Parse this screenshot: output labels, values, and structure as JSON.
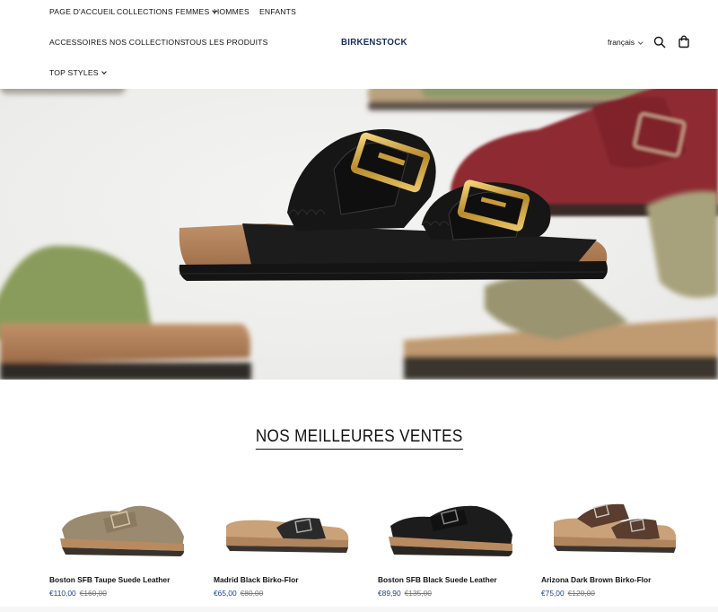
{
  "nav": {
    "items": [
      {
        "label": "PAGE D'ACCUEIL"
      },
      {
        "label": "COLLECTIONS FEMMES"
      },
      {
        "label": "HOMMES"
      },
      {
        "label": "ENFANTS"
      },
      {
        "label": "ACCESSOIRES"
      },
      {
        "label": "NOS COLLECTIONS"
      },
      {
        "label": "TOUS LES PRODUITS"
      },
      {
        "label": "TOP STYLES"
      }
    ]
  },
  "brand": {
    "logo": "BIRKENSTOCK",
    "color": "#1a2b5e"
  },
  "header": {
    "language": "français",
    "icons": [
      "search-icon",
      "shopping-bag-icon"
    ]
  },
  "hero": {
    "image": "sandals-collage"
  },
  "bestsellers": {
    "title": "NOS MEILLEURES VENTES",
    "products": [
      {
        "name": "Boston SFB Taupe Suede Leather",
        "price": "€110,00",
        "old_price": "€160,00",
        "color": "#9a8a70"
      },
      {
        "name": "Madrid Black Birko-Flor",
        "price": "€65,00",
        "old_price": "€80,00",
        "color": "#2a2a2a"
      },
      {
        "name": "Boston SFB Black Suede Leather",
        "price": "€89,90",
        "old_price": "€135,00",
        "color": "#1c1c1c"
      },
      {
        "name": "Arizona Dark Brown Birko-Flor",
        "price": "€75,00",
        "old_price": "€120,00",
        "color": "#5a3d2e"
      }
    ]
  },
  "colors": {
    "price": "#1a3f8f",
    "text": "#111111"
  }
}
